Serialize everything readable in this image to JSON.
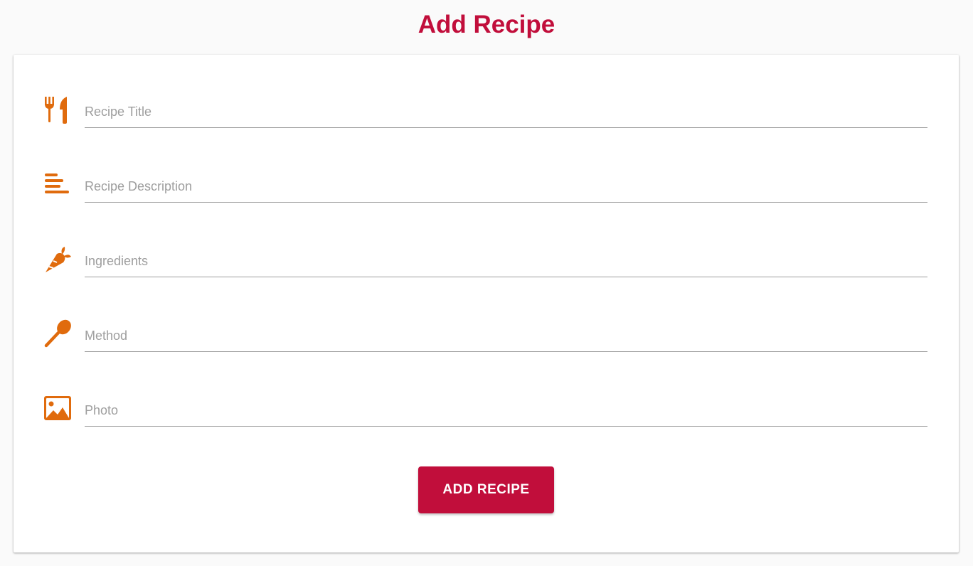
{
  "header": {
    "title": "Add Recipe"
  },
  "form": {
    "fields": [
      {
        "name": "title",
        "icon": "restaurant-icon",
        "placeholder": "Recipe Title",
        "value": ""
      },
      {
        "name": "description",
        "icon": "notes-icon",
        "placeholder": "Recipe Description",
        "value": ""
      },
      {
        "name": "ingredients",
        "icon": "carrot-icon",
        "placeholder": "Ingredients",
        "value": ""
      },
      {
        "name": "method",
        "icon": "spoon-icon",
        "placeholder": "Method",
        "value": ""
      },
      {
        "name": "photo",
        "icon": "image-icon",
        "placeholder": "Photo",
        "value": ""
      }
    ],
    "submit_label": "ADD RECIPE"
  },
  "colors": {
    "accent": "#c10e3b",
    "icon": "#e06b0d",
    "underline": "#9e9e9e",
    "placeholder": "#9e9e9e"
  }
}
